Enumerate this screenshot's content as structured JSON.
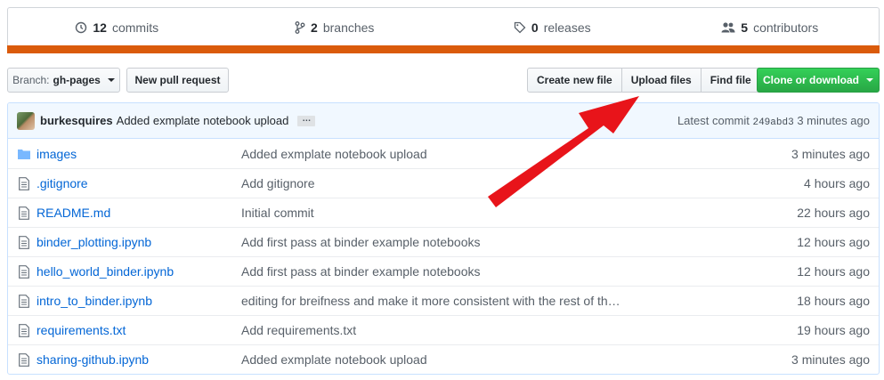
{
  "summary": {
    "commits_count": "12",
    "commits_label": "commits",
    "branches_count": "2",
    "branches_label": "branches",
    "releases_count": "0",
    "releases_label": "releases",
    "contributors_count": "5",
    "contributors_label": "contributors",
    "language_color": "#da5b0b"
  },
  "toolbar": {
    "branch_prefix": "Branch:",
    "branch_name": "gh-pages",
    "new_pull_request": "New pull request",
    "create_new_file": "Create new file",
    "upload_files": "Upload files",
    "find_file": "Find file",
    "clone_or_download": "Clone or download"
  },
  "commit": {
    "author": "burkesquires",
    "message": "Added exmplate notebook upload",
    "ellipsis": "…",
    "latest_prefix": "Latest commit",
    "sha": "249abd3",
    "age": "3 minutes ago"
  },
  "files": [
    {
      "name": "images",
      "icon": "folder-icon",
      "message": "Added exmplate notebook upload",
      "age": "3 minutes ago"
    },
    {
      "name": ".gitignore",
      "icon": "file-icon",
      "message": "Add gitignore",
      "age": "4 hours ago"
    },
    {
      "name": "README.md",
      "icon": "file-icon",
      "message": "Initial commit",
      "age": "22 hours ago"
    },
    {
      "name": "binder_plotting.ipynb",
      "icon": "file-icon",
      "message": "Add first pass at binder example notebooks",
      "age": "12 hours ago"
    },
    {
      "name": "hello_world_binder.ipynb",
      "icon": "file-icon",
      "message": "Add first pass at binder example notebooks",
      "age": "12 hours ago"
    },
    {
      "name": "intro_to_binder.ipynb",
      "icon": "file-icon",
      "message": "editing for breifness and make it more consistent with the rest of th…",
      "age": "18 hours ago"
    },
    {
      "name": "requirements.txt",
      "icon": "file-icon",
      "message": "Add requirements.txt",
      "age": "19 hours ago"
    },
    {
      "name": "sharing-github.ipynb",
      "icon": "file-icon",
      "message": "Added exmplate notebook upload",
      "age": "3 minutes ago"
    }
  ],
  "annotation": {
    "arrow_color": "#e8141a"
  }
}
